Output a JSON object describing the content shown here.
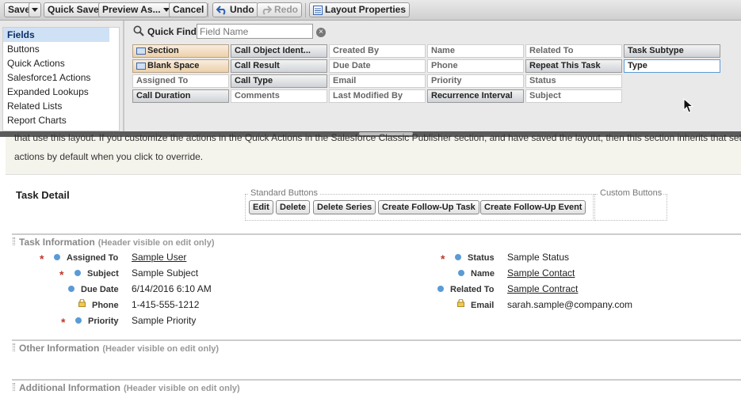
{
  "toolbar": {
    "save": "Save",
    "quick_save": "Quick Save",
    "preview_as": "Preview As...",
    "cancel": "Cancel",
    "undo": "Undo",
    "redo": "Redo",
    "layout_properties": "Layout Properties"
  },
  "palette": {
    "categories": [
      "Fields",
      "Buttons",
      "Quick Actions",
      "Salesforce1 Actions",
      "Expanded Lookups",
      "Related Lists",
      "Report Charts"
    ],
    "selected_category": "Fields",
    "quick_find_label": "Quick Find",
    "quick_find_placeholder": "Field Name",
    "fields": [
      "Section",
      "Call Object Ident...",
      "Created By",
      "Name",
      "Related To",
      "Task Subtype",
      "Blank Space",
      "Call Result",
      "Due Date",
      "Phone",
      "Repeat This Task",
      "Type",
      "Assigned To",
      "Call Type",
      "Email",
      "Priority",
      "Status",
      "Call Duration",
      "Comments",
      "Last Modified By",
      "Recurrence Interval",
      "Subject"
    ]
  },
  "notice": {
    "line1": "that use this layout. If you customize the actions in the Quick Actions in the Salesforce Classic Publisher section, and have saved the layout, then this section inherits that set of",
    "line2": "actions by default when you click to override."
  },
  "detail": {
    "title": "Task Detail",
    "standard_buttons_label": "Standard Buttons",
    "custom_buttons_label": "Custom Buttons",
    "buttons": [
      "Edit",
      "Delete",
      "Delete Series",
      "Create Follow-Up Task",
      "Create Follow-Up Event"
    ]
  },
  "sections": [
    {
      "title": "Task Information",
      "subtitle": "(Header visible on edit only)"
    },
    {
      "title": "Other Information",
      "subtitle": "(Header visible on edit only)"
    },
    {
      "title": "Additional Information",
      "subtitle": "(Header visible on edit only)"
    }
  ],
  "task_info": {
    "left": [
      {
        "label": "Assigned To",
        "value": "Sample User"
      },
      {
        "label": "Subject",
        "value": "Sample Subject"
      },
      {
        "label": "Due Date",
        "value": "6/14/2016 6:10 AM"
      },
      {
        "label": "Phone",
        "value": "1-415-555-1212"
      },
      {
        "label": "Priority",
        "value": "Sample Priority"
      }
    ],
    "right": [
      {
        "label": "Status",
        "value": "Sample Status"
      },
      {
        "label": "Name",
        "value": "Sample Contact"
      },
      {
        "label": "Related To",
        "value": "Sample Contract"
      },
      {
        "label": "Email",
        "value": "sarah.sample@company.com"
      }
    ]
  },
  "colors": {
    "required": "#c0392b",
    "field_dot": "#5b9bd5",
    "selected_category": "#cfe1f5"
  }
}
